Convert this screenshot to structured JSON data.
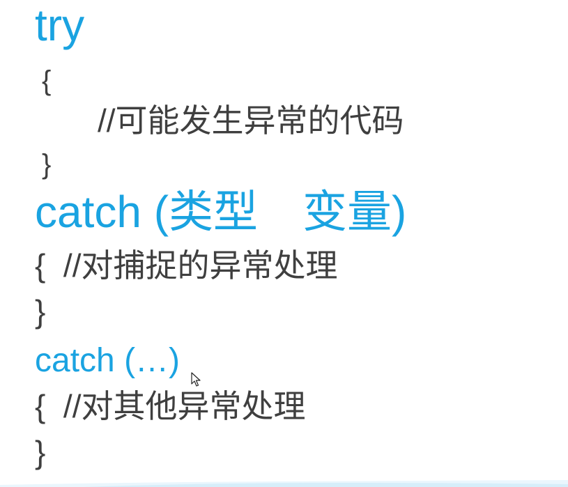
{
  "code": {
    "try_kw": "try",
    "try_open": "{",
    "try_comment": "//可能发生异常的代码",
    "try_close": "}",
    "catch1_kw": "catch (类型　变量)",
    "catch1_open": "{",
    "catch1_comment": "  //对捕捉的异常处理",
    "catch1_close": "}",
    "catch2_kw": "catch (…)",
    "catch2_open": "{",
    "catch2_comment": "  //对其他异常处理",
    "catch2_close": "}"
  },
  "colors": {
    "keyword": "#1aa3e1",
    "text": "#3f3f3f",
    "background": "#ffffff"
  },
  "icons": {
    "cursor": "mouse-pointer-icon"
  }
}
